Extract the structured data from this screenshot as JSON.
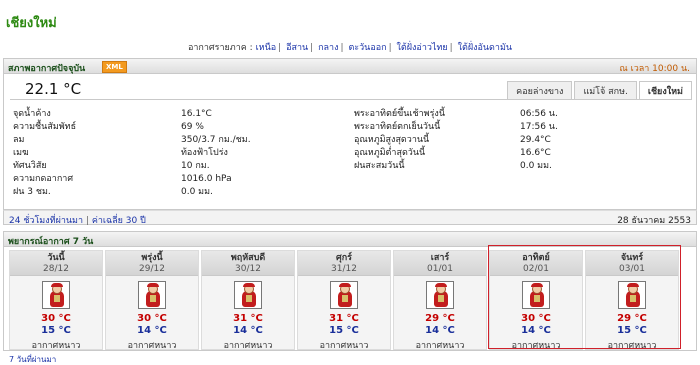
{
  "page": {
    "title": "เชียงใหม่"
  },
  "regions": {
    "prefix": "อากาศรายภาค :",
    "links": [
      "เหนือ",
      "อีสาน",
      "กลาง",
      "ตะวันออก",
      "ใต้ฝั่งอ่าวไทย",
      "ใต้ฝั่งอันดามัน"
    ]
  },
  "current": {
    "header": "สภาพอากาศปัจจุบัน",
    "xml_badge": "XML",
    "time": "ณ เวลา 10:00 น.",
    "temperature": "22.1 °C",
    "tabs": [
      {
        "label": "คอยล่างขาง",
        "active": false
      },
      {
        "label": "แม่โจ้ สกษ.",
        "active": false
      },
      {
        "label": "เชียงใหม่",
        "active": true
      }
    ],
    "left": [
      {
        "k": "จุดน้ำค้าง",
        "v": "16.1°C"
      },
      {
        "k": "ความชื้นสัมพัทธ์",
        "v": "69 %"
      },
      {
        "k": "ลม",
        "v": "350/3.7 กม./ชม."
      },
      {
        "k": "เมฆ",
        "v": "ท้องฟ้าโปร่ง"
      },
      {
        "k": "ทัศนวิสัย",
        "v": "10 กม."
      },
      {
        "k": "ความกดอากาศ",
        "v": "1016.0 hPa"
      },
      {
        "k": "ฝน 3 ชม.",
        "v": "0.0 มม."
      }
    ],
    "right": [
      {
        "k": "",
        "v": ""
      },
      {
        "k": "พระอาทิตย์ขึ้นเช้าพรุ่งนี้",
        "v": "06:56 น."
      },
      {
        "k": "พระอาทิตย์ตกเย็นวันนี้",
        "v": "17:56 น."
      },
      {
        "k": "อุณหภูมิสูงสุดวานนี้",
        "v": "29.4°C"
      },
      {
        "k": "อุณหภูมิต่ำสุดวันนี้",
        "v": "16.6°C"
      },
      {
        "k": "ฝนสะสมวันนี้",
        "v": "0.0 มม."
      }
    ],
    "footer_link_1": "24 ชั่วโมงที่ผ่านมา",
    "footer_link_2": "ค่าเฉลี่ย 30 ปี",
    "footer_date": "28 ธันวาคม 2553"
  },
  "forecast": {
    "header": "พยากรณ์อากาศ 7 วัน",
    "days": [
      {
        "name": "วันนี้",
        "date": "28/12",
        "high": "30 °C",
        "low": "15 °C",
        "cond": "อากาศหนาว"
      },
      {
        "name": "พรุ่งนี้",
        "date": "29/12",
        "high": "30 °C",
        "low": "14 °C",
        "cond": "อากาศหนาว"
      },
      {
        "name": "พฤหัสบดี",
        "date": "30/12",
        "high": "31 °C",
        "low": "14 °C",
        "cond": "อากาศหนาว"
      },
      {
        "name": "ศุกร์",
        "date": "31/12",
        "high": "31 °C",
        "low": "15 °C",
        "cond": "อากาศหนาว"
      },
      {
        "name": "เสาร์",
        "date": "01/01",
        "high": "29 °C",
        "low": "14 °C",
        "cond": "อากาศหนาว"
      },
      {
        "name": "อาทิตย์",
        "date": "02/01",
        "high": "30 °C",
        "low": "14 °C",
        "cond": "อากาศหนาว"
      },
      {
        "name": "จันทร์",
        "date": "03/01",
        "high": "29 °C",
        "low": "15 °C",
        "cond": "อากาศหนาว"
      }
    ],
    "footer_link": "7 วันที่ผ่านมา"
  }
}
